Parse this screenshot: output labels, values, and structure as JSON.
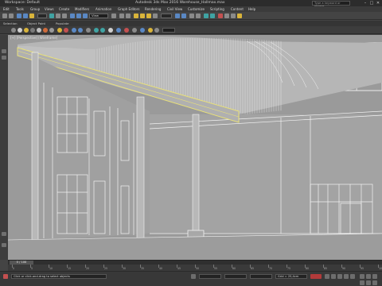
{
  "window": {
    "workspace": "Workspace: Default",
    "title": "Autodesk 3ds Max 2016    Warehouse_Hallmax.max",
    "search_placeholder": "Type a keyword or phrase"
  },
  "menu": [
    {
      "label": "Edit"
    },
    {
      "label": "Tools"
    },
    {
      "label": "Group"
    },
    {
      "label": "Views"
    },
    {
      "label": "Create"
    },
    {
      "label": "Modifiers"
    },
    {
      "label": "Animation"
    },
    {
      "label": "Graph Editors"
    },
    {
      "label": "Rendering"
    },
    {
      "label": "Civil View"
    },
    {
      "label": "Customize"
    },
    {
      "label": "Scripting"
    },
    {
      "label": "Content"
    },
    {
      "label": "Help"
    }
  ],
  "toolbar": {
    "view_dropdown": "View"
  },
  "ribbon_tabs": [
    {
      "label": "Selection"
    },
    {
      "label": "Object Paint"
    },
    {
      "label": "Populate"
    }
  ],
  "viewport": {
    "label": "[+] [Perspective] [Wireframe]"
  },
  "timeline": {
    "frame_counter": "0 / 100",
    "ticks": [
      "0",
      "5",
      "10",
      "15",
      "20",
      "25",
      "30",
      "35",
      "40",
      "45",
      "50",
      "55",
      "60",
      "65",
      "70",
      "75",
      "80",
      "85",
      "90",
      "95",
      "100"
    ]
  },
  "status": {
    "message": "Click or click-and-drag to select objects",
    "grid": "Grid = 25,4cm",
    "auto_key": "Auto Key",
    "set_key": "Set Key",
    "selected": "Selected",
    "key_filters": "Key Filters..."
  },
  "colors": {
    "viewport_bg": "#9a9a9a",
    "wire": "#f2f2f2",
    "selection": "#e8e07a",
    "autokey": "#b23a3a"
  }
}
